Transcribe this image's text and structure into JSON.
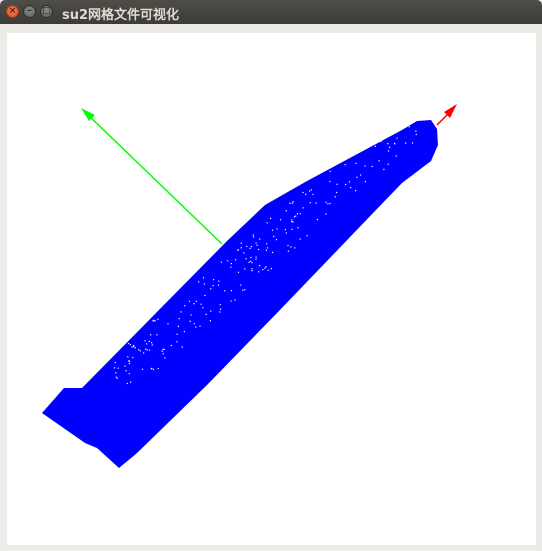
{
  "window": {
    "title": "su2网格文件可视化"
  },
  "titlebar_buttons": {
    "close_glyph": "×",
    "minimize_glyph": "–",
    "maximize_glyph": "□"
  },
  "viewport": {
    "background": "#ffffff",
    "mesh_color": "#0000ff",
    "mesh_point_color": "#ffffff",
    "axis_x_color": "#ff0000",
    "axis_y_color": "#00ff00"
  }
}
